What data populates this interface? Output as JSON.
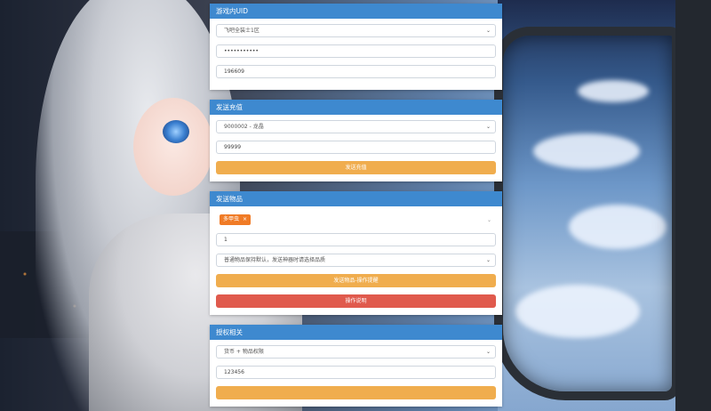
{
  "colors": {
    "panel_header": "#3e89cf",
    "warning_button": "#f0ad4e",
    "danger_button": "#e05a4d",
    "tag": "#f07b26"
  },
  "panels": {
    "uid": {
      "title": "游戏内UID",
      "server_select": "飞吧全装士1区",
      "password": "•••••••••••",
      "uid_value": "196609"
    },
    "recharge": {
      "title": "发送充值",
      "currency_select": "9000002 - 龙晶",
      "amount": "99999",
      "send_button": "发送充值"
    },
    "items": {
      "title": "发送物品",
      "selected_tag": "多甲虫",
      "tag_remove": "×",
      "quantity": "1",
      "quality_select": "普通物品保持默认，发送神器时请选择品质",
      "send_button": "发送物品-操作提醒",
      "danger_button": "操作说明"
    },
    "auth": {
      "title": "授权相关",
      "type_select": "货币 + 物品权限",
      "code": "123456"
    }
  },
  "icons": {
    "select_arrow": "chevron-down-icon"
  }
}
